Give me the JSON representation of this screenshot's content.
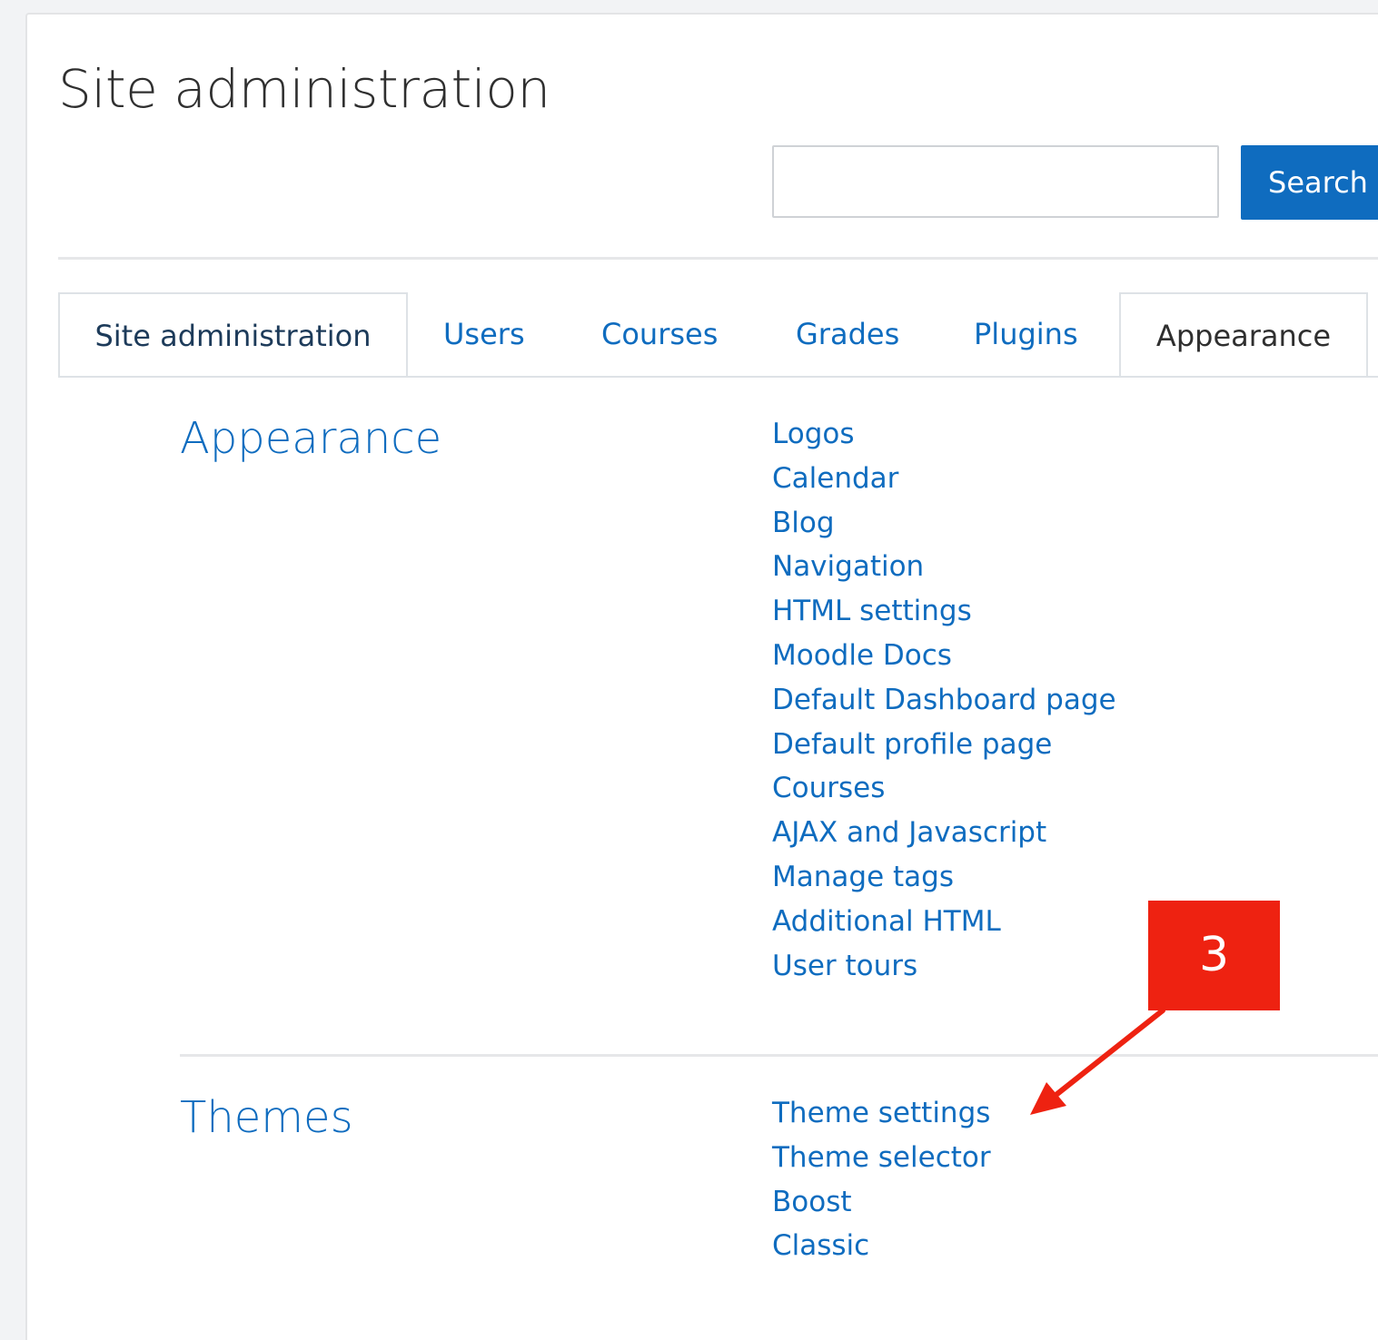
{
  "page": {
    "title": "Site administration"
  },
  "search": {
    "value": "",
    "placeholder": "",
    "button_label": "Search"
  },
  "tabs": [
    {
      "label": "Site administration",
      "boxed": true
    },
    {
      "label": "Users",
      "boxed": false
    },
    {
      "label": "Courses",
      "boxed": false
    },
    {
      "label": "Grades",
      "boxed": false
    },
    {
      "label": "Plugins",
      "boxed": false
    },
    {
      "label": "Appearance",
      "boxed": true,
      "active": true
    }
  ],
  "sections": [
    {
      "heading": "Appearance",
      "links": [
        "Logos",
        "Calendar",
        "Blog",
        "Navigation",
        "HTML settings",
        "Moodle Docs",
        "Default Dashboard page",
        "Default profile page",
        "Courses",
        "AJAX and Javascript",
        "Manage tags",
        "Additional HTML",
        "User tours"
      ]
    },
    {
      "heading": "Themes",
      "links": [
        "Theme settings",
        "Theme selector",
        "Boost",
        "Classic"
      ]
    }
  ],
  "annotation": {
    "label": "3",
    "color": "#ee2211",
    "points_to": "Theme settings"
  },
  "colors": {
    "link": "#0f6cbf",
    "primary_button": "#0f6cbf",
    "title_text": "#2f2f2f"
  }
}
